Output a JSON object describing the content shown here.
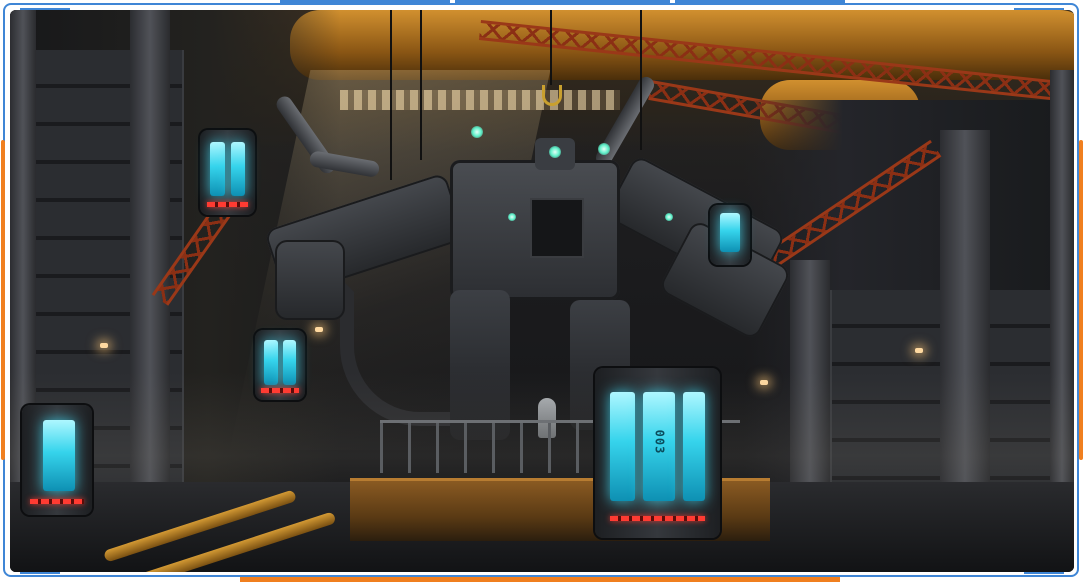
{
  "scene": {
    "description_free": true,
    "pods": [
      {
        "id": "center-pod",
        "label": "003"
      },
      {
        "id": "left-pod-near",
        "label": ""
      },
      {
        "id": "left-pod-mid",
        "label": ""
      },
      {
        "id": "left-pod-high",
        "label": ""
      },
      {
        "id": "right-pod-high",
        "label": ""
      }
    ]
  },
  "frame": {
    "accent_color": "#3f86d6",
    "secondary_color": "#f07f1f"
  },
  "icons": {
    "mech": "mech-robot-icon",
    "hook": "crane-hook-icon"
  }
}
